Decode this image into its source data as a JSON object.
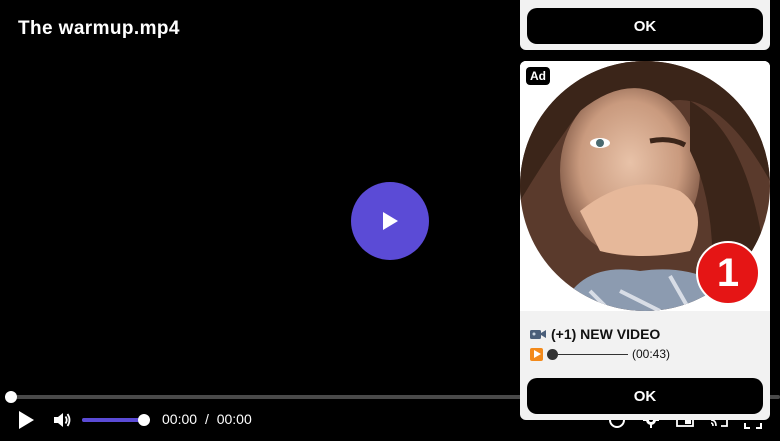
{
  "player": {
    "title": "The warmup.mp4",
    "current_time": "00:00",
    "separator": "/",
    "duration": "00:00",
    "progress": 0,
    "volume": 1.0,
    "accent_color": "#5b4bd6"
  },
  "icons": {
    "big_play": "play-icon",
    "play": "play-icon",
    "volume": "volume-icon",
    "captions": "captions-icon",
    "settings": "gear-icon",
    "pip": "picture-in-picture-icon",
    "cast": "cast-icon",
    "fullscreen": "fullscreen-icon"
  },
  "ad_top": {
    "ok_label": "OK"
  },
  "ad_card": {
    "badge": "Ad",
    "notification_count": "1",
    "title": "(+1) NEW VIDEO",
    "subtitle_time": "(00:43)",
    "ok_label": "OK",
    "notification_color": "#e51515"
  }
}
